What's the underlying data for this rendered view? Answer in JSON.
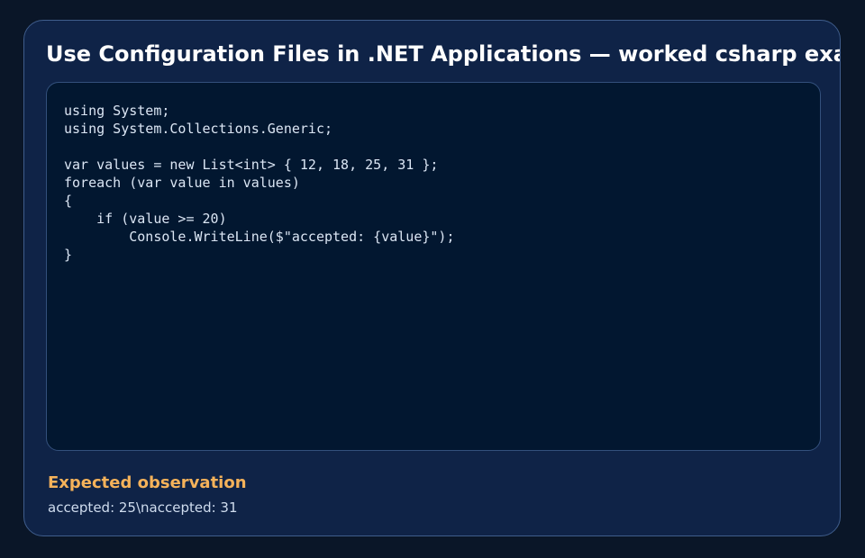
{
  "card": {
    "title": "Use Configuration Files in .NET Applications — worked csharp example",
    "code": "using System;\nusing System.Collections.Generic;\n\nvar values = new List<int> { 12, 18, 25, 31 };\nforeach (var value in values)\n{\n    if (value >= 20)\n        Console.WriteLine($\"accepted: {value}\");\n}",
    "observation": {
      "heading": "Expected observation",
      "text": "accepted: 25\\naccepted: 31"
    }
  },
  "colors": {
    "page_background": "#0a1628",
    "card_background": "#0f2347",
    "code_background": "#021730",
    "title_text": "#ffffff",
    "code_text": "#dbe6f4",
    "observation_heading": "#f5b25a",
    "observation_text": "#cfdcee"
  }
}
